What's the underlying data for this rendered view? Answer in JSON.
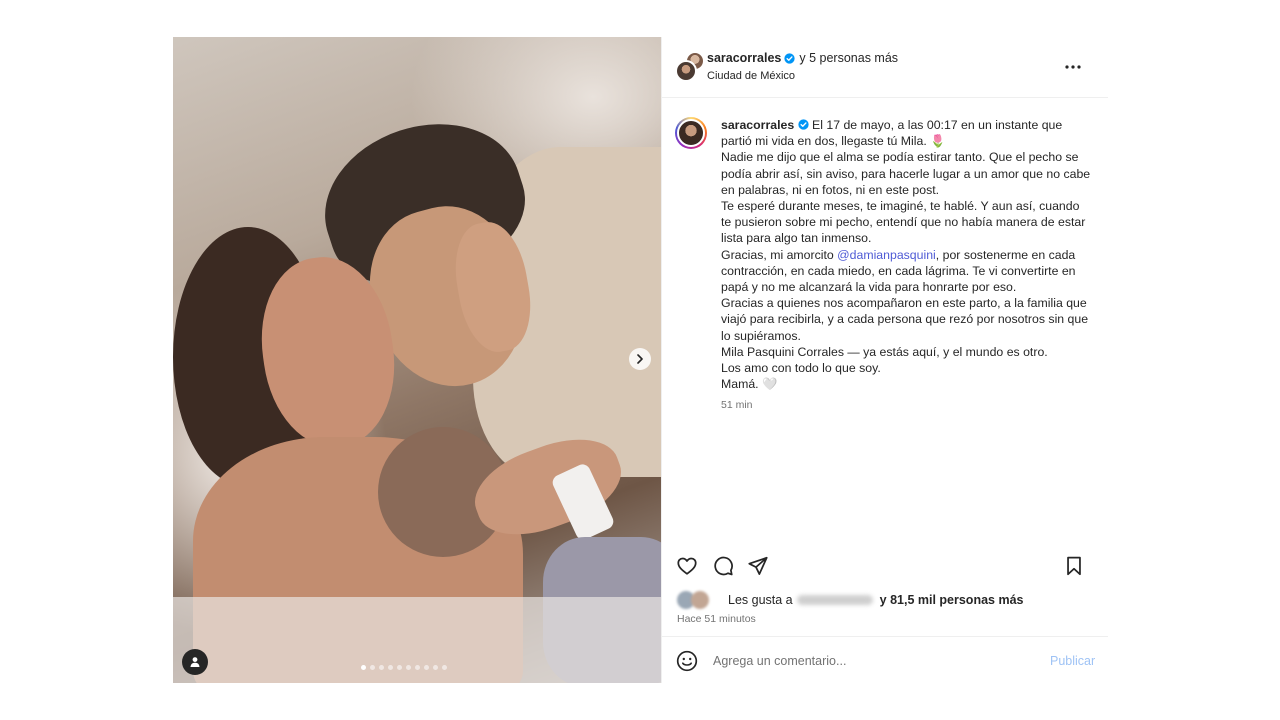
{
  "post": {
    "media": {
      "photo_description_icon": "photo-icon",
      "carousel_dot_count": 10,
      "carousel_active_index": 0
    },
    "header": {
      "username": "saracorrales",
      "coauthors_text": "y 5 personas más",
      "location": "Ciudad de México"
    },
    "caption": {
      "username": "saracorrales",
      "paragraphs": [
        "El 17 de mayo, a las 00:17 en un instante que partió mi vida en dos, llegaste tú Mila. 🌷",
        "Nadie me dijo que el alma se podía estirar tanto. Que el pecho se podía abrir así, sin aviso, para hacerle lugar a un amor que no cabe en palabras, ni en fotos, ni en este post.",
        "Te esperé durante meses, te imaginé, te hablé. Y aun así, cuando te pusieron sobre mi pecho, entendí que no había manera de estar lista para algo tan inmenso.",
        "Gracias, mi amorcito",
        "@damianpasquini",
        ", por sostenerme en cada contracción, en cada miedo, en cada lágrima. Te vi convertirte en papá y no me alcanzará la vida para honrarte por eso.",
        "Gracias a quienes nos acompañaron en este parto, a la familia que viajó para recibirla, y a cada persona que rezó por nosotros sin que lo supiéramos.",
        "Mila Pasquini Corrales — ya estás aquí, y el mundo es otro.",
        "Los amo con todo lo que soy.",
        "Mamá. 🤍"
      ],
      "time": "51 min"
    },
    "likes": {
      "prefix": "Les gusta a",
      "suffix_bold": "y 81,5 mil personas más"
    },
    "ago": "Hace 51 minutos",
    "comment": {
      "placeholder": "Agrega un comentario...",
      "publish_label": "Publicar"
    },
    "colors": {
      "accent_link": "#4f5bd5",
      "publish_disabled": "#9fc3f5",
      "verified": "#0095f6"
    }
  }
}
